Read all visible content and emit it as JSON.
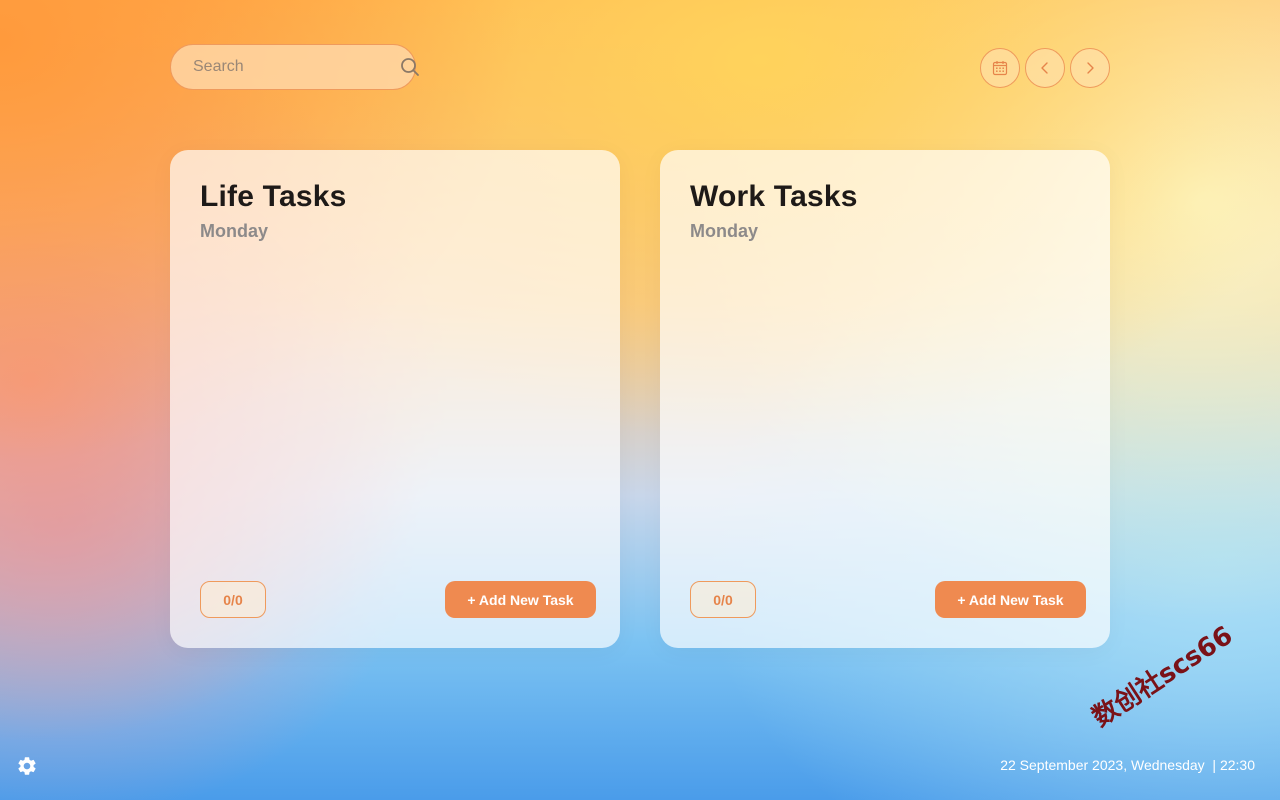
{
  "search": {
    "placeholder": "Search"
  },
  "nav": {
    "calendar_icon": "calendar-icon",
    "prev_icon": "chevron-left-icon",
    "next_icon": "chevron-right-icon"
  },
  "cards": [
    {
      "title": "Life Tasks",
      "day": "Monday",
      "progress": "0/0",
      "add_label": "+ Add New Task"
    },
    {
      "title": "Work Tasks",
      "day": "Monday",
      "progress": "0/0",
      "add_label": "+ Add New Task"
    }
  ],
  "footer": {
    "datetime": "22 September 2023, Wednesday  | 22:30",
    "settings_icon": "gear-icon"
  },
  "watermark": "数创社scs66",
  "colors": {
    "accent": "#ef8a50",
    "accent_border": "#ef9a5c",
    "title_text": "#1e1a18",
    "muted_text": "#8d8a8a"
  }
}
